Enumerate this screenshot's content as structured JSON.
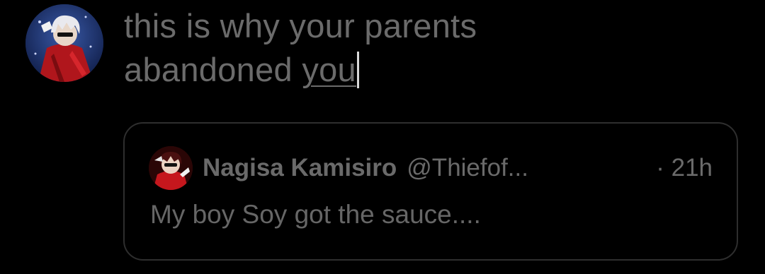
{
  "compose": {
    "line1": "this is why your parents",
    "line2_before": "abandoned ",
    "line2_underlined": "you"
  },
  "quoted_tweet": {
    "author_name": "Nagisa Kamisiro",
    "author_handle": "@Thiefof...",
    "timestamp": "· 21h",
    "text": "My boy Soy got the sauce...."
  },
  "icons": {
    "main_avatar": "user-avatar",
    "quoted_avatar": "quoted-author-avatar",
    "caret": "text-cursor"
  },
  "colors": {
    "background": "#000000",
    "text": "#6b6b6b",
    "card_border": "#2e2e2e",
    "caret": "#d9d9d9"
  }
}
